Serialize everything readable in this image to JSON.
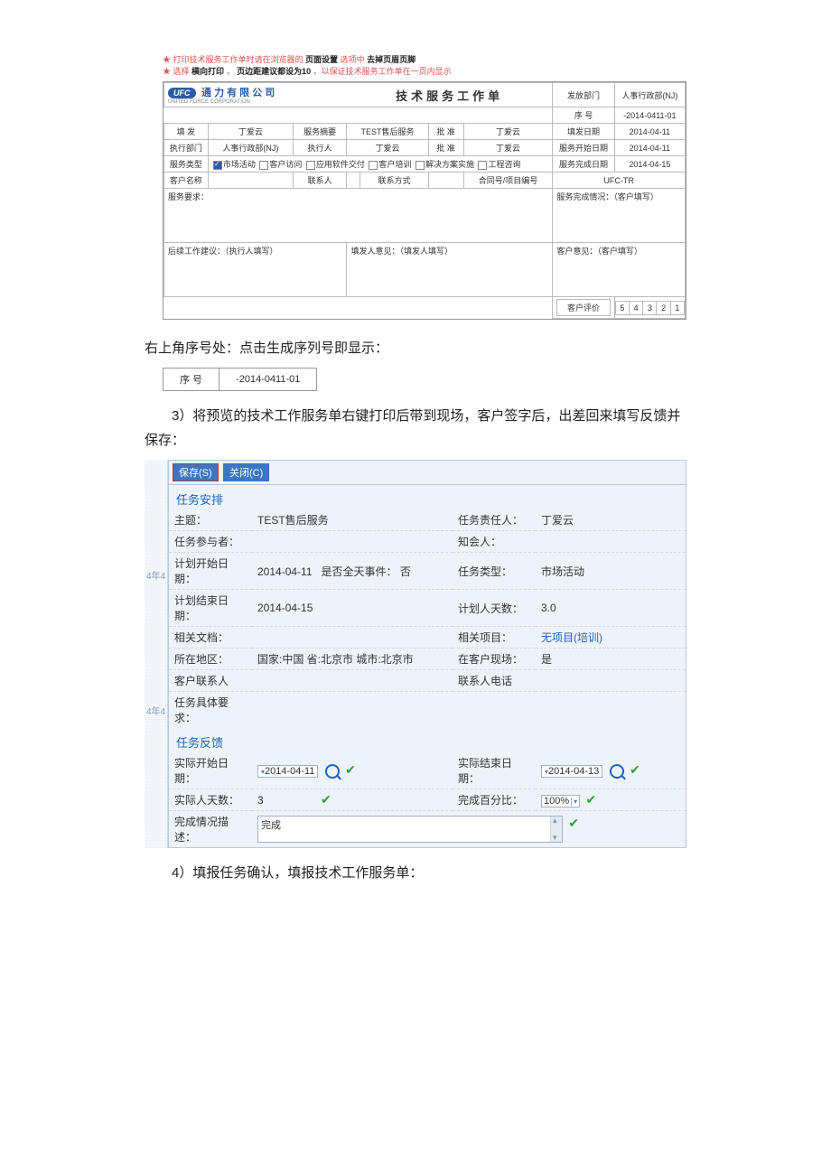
{
  "print_notes": {
    "line1_pre": "打印技术服务工作单时请在浏览器的",
    "line1_b1": "页面设置",
    "line1_mid": "选项中",
    "line1_b2": "去掉页眉页脚",
    "line2_pre": "选择",
    "line2_b1": "横向打印",
    "line2_mid": "，",
    "line2_b2": "页边距建议都设为10",
    "line2_post": "，以保证技术服务工作单在一页内显示"
  },
  "form": {
    "company": "通 力 有 限 公 司",
    "company_en": "UNITED FORCE CORPORATION",
    "title": "技术服务工作单",
    "head": {
      "issue_dept_label": "发放部门",
      "issue_dept": "人事行政部(NJ)",
      "serial_label": "序    号",
      "serial": "-2014-0411-01"
    },
    "row1": {
      "c1l": "填    发",
      "c1": "丁爱云",
      "c2l": "服务摘要",
      "c2": "TEST售后服务",
      "c3l": "批    准",
      "c3": "丁爱云",
      "c4l": "填发日期",
      "c4": "2014-04-11"
    },
    "row2": {
      "c1l": "执行部门",
      "c1": "人事行政部(NJ)",
      "c2l": "执行人",
      "c2": "丁爱云",
      "c3l": "批    准",
      "c3": "丁爱云",
      "c4l": "服务开始日期",
      "c4": "2014-04-11"
    },
    "row3": {
      "c1l": "服务类型",
      "opts": [
        "市场活动",
        "客户访问",
        "应用软件交付",
        "客户培训",
        "解决方案实施",
        "工程咨询"
      ],
      "checked_idx": 0,
      "c4l": "服务完成日期",
      "c4": "2014-04-15"
    },
    "row4": {
      "c1l": "客户名称",
      "c1": "",
      "c2l": "联系人",
      "c2": "",
      "c3l": "联系方式",
      "c3": "",
      "c4l": "合同号/项目编号",
      "c4": "",
      "c5l": "",
      "c5": "UFC-TR"
    },
    "body": {
      "req_label": "服务要求：",
      "done_label": "服务完成情况：（客户填写）",
      "next_label": "后续工作建议：（执行人填写）",
      "issuer_label": "填发人意见：（填发人填写）",
      "cust_label": "客户意见：（客户填写）"
    },
    "rating": {
      "label": "客户评价",
      "vals": [
        "5",
        "4",
        "3",
        "2",
        "1"
      ]
    }
  },
  "para1": "右上角序号处：点击生成序列号即显示：",
  "serial_snip": {
    "label": "序    号",
    "val": "-2014-0411-01"
  },
  "para2": "3）将预览的技术工作服务单右键打印后带到现场，客户签字后，出差回来填写反馈并保存：",
  "task": {
    "side1": "4年4",
    "side2": "4年4",
    "btn_save": "保存(S)",
    "btn_close": "关闭(C)",
    "sec1": "任务安排",
    "subject_l": "主题：",
    "subject": "TEST售后服务",
    "owner_l": "任务责任人：",
    "owner": "丁爱云",
    "part_l": "任务参与者：",
    "part": "",
    "cc_l": "知会人：",
    "cc": "",
    "pstart_l": "计划开始日期：",
    "pstart": "2014-04-11",
    "allday_l": "是否全天事件：",
    "allday": "否",
    "ttype_l": "任务类型：",
    "ttype": "市场活动",
    "pend_l": "计划结束日期：",
    "pend": "2014-04-15",
    "days_l": "计划人天数：",
    "days": "3.0",
    "doc_l": "相关文档：",
    "doc": "",
    "proj_l": "相关项目：",
    "proj": "无项目(培训)",
    "loc_l": "所在地区：",
    "loc": "国家:中国  省:北京市  城市:北京市",
    "onsite_l": "在客户现场：",
    "onsite": "是",
    "contact_l": "客户联系人",
    "contact": "",
    "phone_l": "联系人电话",
    "phone": "",
    "req_l": "任务具体要求：",
    "req": "",
    "sec2": "任务反馈",
    "astart_l": "实际开始日期：",
    "astart": "2014-04-11",
    "aend_l": "实际结束日期：",
    "aend": "2014-04-13",
    "adays_l": "实际人天数：",
    "adays": "3",
    "pct_l": "完成百分比：",
    "pct": "100%",
    "desc_l": "完成情况描述：",
    "desc": "完成"
  },
  "para3": "4）填报任务确认，填报技术工作服务单："
}
